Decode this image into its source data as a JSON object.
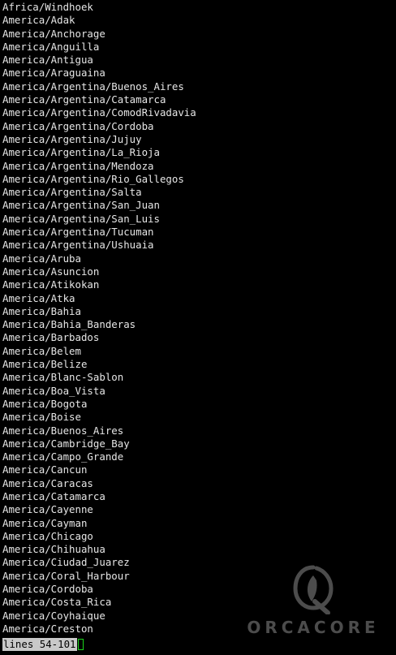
{
  "terminal": {
    "lines": [
      "Africa/Windhoek",
      "America/Adak",
      "America/Anchorage",
      "America/Anguilla",
      "America/Antigua",
      "America/Araguaina",
      "America/Argentina/Buenos_Aires",
      "America/Argentina/Catamarca",
      "America/Argentina/ComodRivadavia",
      "America/Argentina/Cordoba",
      "America/Argentina/Jujuy",
      "America/Argentina/La_Rioja",
      "America/Argentina/Mendoza",
      "America/Argentina/Rio_Gallegos",
      "America/Argentina/Salta",
      "America/Argentina/San_Juan",
      "America/Argentina/San_Luis",
      "America/Argentina/Tucuman",
      "America/Argentina/Ushuaia",
      "America/Aruba",
      "America/Asuncion",
      "America/Atikokan",
      "America/Atka",
      "America/Bahia",
      "America/Bahia_Banderas",
      "America/Barbados",
      "America/Belem",
      "America/Belize",
      "America/Blanc-Sablon",
      "America/Boa_Vista",
      "America/Bogota",
      "America/Boise",
      "America/Buenos_Aires",
      "America/Cambridge_Bay",
      "America/Campo_Grande",
      "America/Cancun",
      "America/Caracas",
      "America/Catamarca",
      "America/Cayenne",
      "America/Cayman",
      "America/Chicago",
      "America/Chihuahua",
      "America/Ciudad_Juarez",
      "America/Coral_Harbour",
      "America/Cordoba",
      "America/Costa_Rica",
      "America/Coyhaique",
      "America/Creston"
    ],
    "status": "lines 54-101",
    "colors": {
      "background": "#000000",
      "text": "#e6e6e6",
      "status_bg": "#c9c9c9",
      "cursor": "#1bd41b"
    }
  },
  "watermark": {
    "text": "ORCACORE",
    "icon": "orca-q-logo-icon"
  }
}
